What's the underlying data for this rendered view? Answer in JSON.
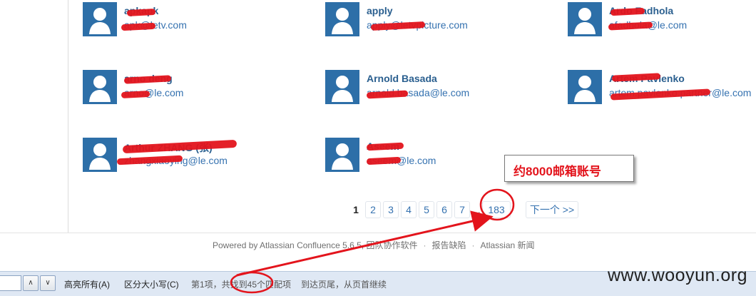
{
  "people": [
    {
      "name": "apkapk",
      "email": "apk@letv.com"
    },
    {
      "name": "apply",
      "email": "apply@letvpicture.com"
    },
    {
      "name": "Ardo Fadhola",
      "email": "afadhola@le.com"
    },
    {
      "name": "arno deng",
      "email": "arno@le.com"
    },
    {
      "name": "Arnold Basada",
      "email": "arnold.basada@le.com"
    },
    {
      "name": "Artem Pavlenko",
      "email": "artem.pavlenko.partner@le.com"
    },
    {
      "name": "Arthur ZHANG (张)",
      "email": "zhangxiaoying@le.com"
    },
    {
      "name": "Aseem",
      "email": "aseem@le.com"
    }
  ],
  "pagination": {
    "current": "1",
    "pages": [
      "2",
      "3",
      "4",
      "5",
      "6",
      "7"
    ],
    "ellipsis": "...",
    "last": "183",
    "next": "下一个 >>"
  },
  "footer": {
    "powered_by": "Powered by Atlassian Confluence 5.6.5, 团队协作软件",
    "report_bug": "报告缺陷",
    "news": "Atlassian 新闻",
    "separator": "·"
  },
  "findbar": {
    "highlight_all": "高亮所有(A)",
    "match_case": "区分大小写(C)",
    "status": "第1项，共找到45个匹配项",
    "wrap_notice": "到达页尾，从页首继续",
    "up_arrow": "∧",
    "down_arrow": "∨"
  },
  "annotation": {
    "callout_text": "约8000邮箱账号",
    "highlight_color": "#e3141c"
  },
  "watermark": "www.wooyun.org"
}
